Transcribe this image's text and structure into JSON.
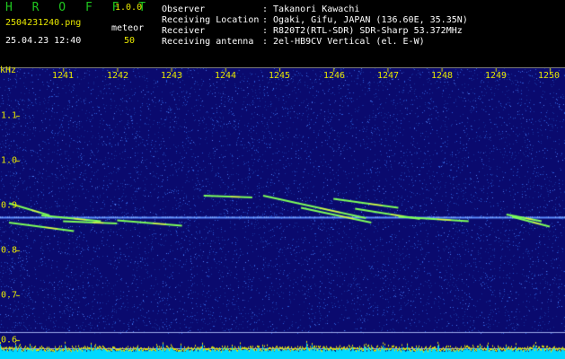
{
  "header": {
    "app_name": "H R O F F T",
    "version": "1.0.0",
    "filename": "2504231240.png",
    "timestamp": "25.04.23 12:40",
    "meteor_label": "meteor",
    "meteor_count": "50"
  },
  "station_info": [
    {
      "key": "Observer",
      "value": ": Takanori Kawachi"
    },
    {
      "key": "Receiving Location",
      "value": ": Ogaki, Gifu, JAPAN (136.60E, 35.35N)"
    },
    {
      "key": "Receiver",
      "value": ": R820T2(RTL-SDR) SDR-Sharp 53.372MHz"
    },
    {
      "key": "Receiving antenna",
      "value": ": 2el-HB9CV Vertical (el. E-W)"
    }
  ],
  "spectrogram": {
    "y_unit": "kHz",
    "x_ticks": [
      "1241",
      "1242",
      "1243",
      "1244",
      "1245",
      "1246",
      "1247",
      "1248",
      "1249",
      "1250"
    ],
    "y_ticks": [
      "1.1",
      "1.0",
      "0.9",
      "0.8",
      "0.7",
      "0.6"
    ],
    "x_range": [
      1240,
      1250
    ],
    "y_range": [
      0.575,
      1.2
    ],
    "carrier_khz": 0.873,
    "colors": {
      "background": "#0a0a6e",
      "noise": "#2a5ad8",
      "carrier": "#5a8cff",
      "trail": "#7dff5a",
      "trail_core": "#ffe640",
      "tick": "#e8e800",
      "bottom_bar": "#00d8ff"
    },
    "meteor_trails": [
      {
        "from": [
          1240.0,
          0.905
        ],
        "to": [
          1240.75,
          0.878
        ]
      },
      {
        "from": [
          1240.6,
          0.878
        ],
        "to": [
          1241.7,
          0.865
        ]
      },
      {
        "from": [
          1241.0,
          0.865
        ],
        "to": [
          1242.0,
          0.86
        ]
      },
      {
        "from": [
          1240.0,
          0.862
        ],
        "to": [
          1241.2,
          0.843
        ]
      },
      {
        "from": [
          1243.6,
          0.922
        ],
        "to": [
          1244.5,
          0.918
        ]
      },
      {
        "from": [
          1244.7,
          0.922
        ],
        "to": [
          1246.6,
          0.872
        ]
      },
      {
        "from": [
          1246.0,
          0.915
        ],
        "to": [
          1247.2,
          0.895
        ]
      },
      {
        "from": [
          1246.4,
          0.893
        ],
        "to": [
          1247.6,
          0.87
        ]
      },
      {
        "from": [
          1245.4,
          0.895
        ],
        "to": [
          1246.7,
          0.862
        ]
      },
      {
        "from": [
          1247.2,
          0.875
        ],
        "to": [
          1248.5,
          0.865
        ]
      },
      {
        "from": [
          1249.2,
          0.88
        ],
        "to": [
          1249.85,
          0.865
        ]
      },
      {
        "from": [
          1249.3,
          0.875
        ],
        "to": [
          1250.0,
          0.853
        ]
      },
      {
        "from": [
          1242.0,
          0.867
        ],
        "to": [
          1243.2,
          0.855
        ]
      }
    ]
  }
}
